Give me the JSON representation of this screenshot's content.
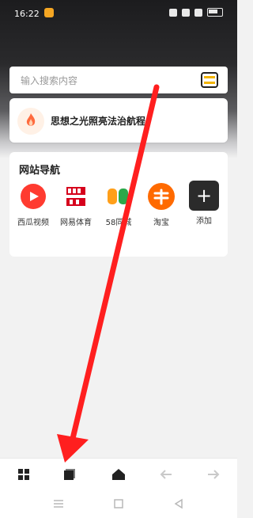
{
  "status_bar": {
    "time": "16:22"
  },
  "search": {
    "placeholder": "输入搜索内容"
  },
  "news": {
    "title": "思想之光照亮法治航程"
  },
  "nav": {
    "title": "网站导航",
    "items": [
      {
        "label": "西瓜视频",
        "icon": "xigua-video-icon"
      },
      {
        "label": "网易体育",
        "icon": "netease-sports-icon"
      },
      {
        "label": "58同城",
        "icon": "58-tongcheng-icon"
      },
      {
        "label": "淘宝",
        "icon": "taobao-icon"
      },
      {
        "label": "添加",
        "icon": "add-icon"
      }
    ]
  },
  "bottom_nav": [
    "grid-icon",
    "tabs-icon",
    "home-icon",
    "back-arrow-icon",
    "forward-arrow-icon"
  ],
  "colors": {
    "accent_red": "#ff1f1f",
    "taobao_orange": "#ff6a00"
  }
}
